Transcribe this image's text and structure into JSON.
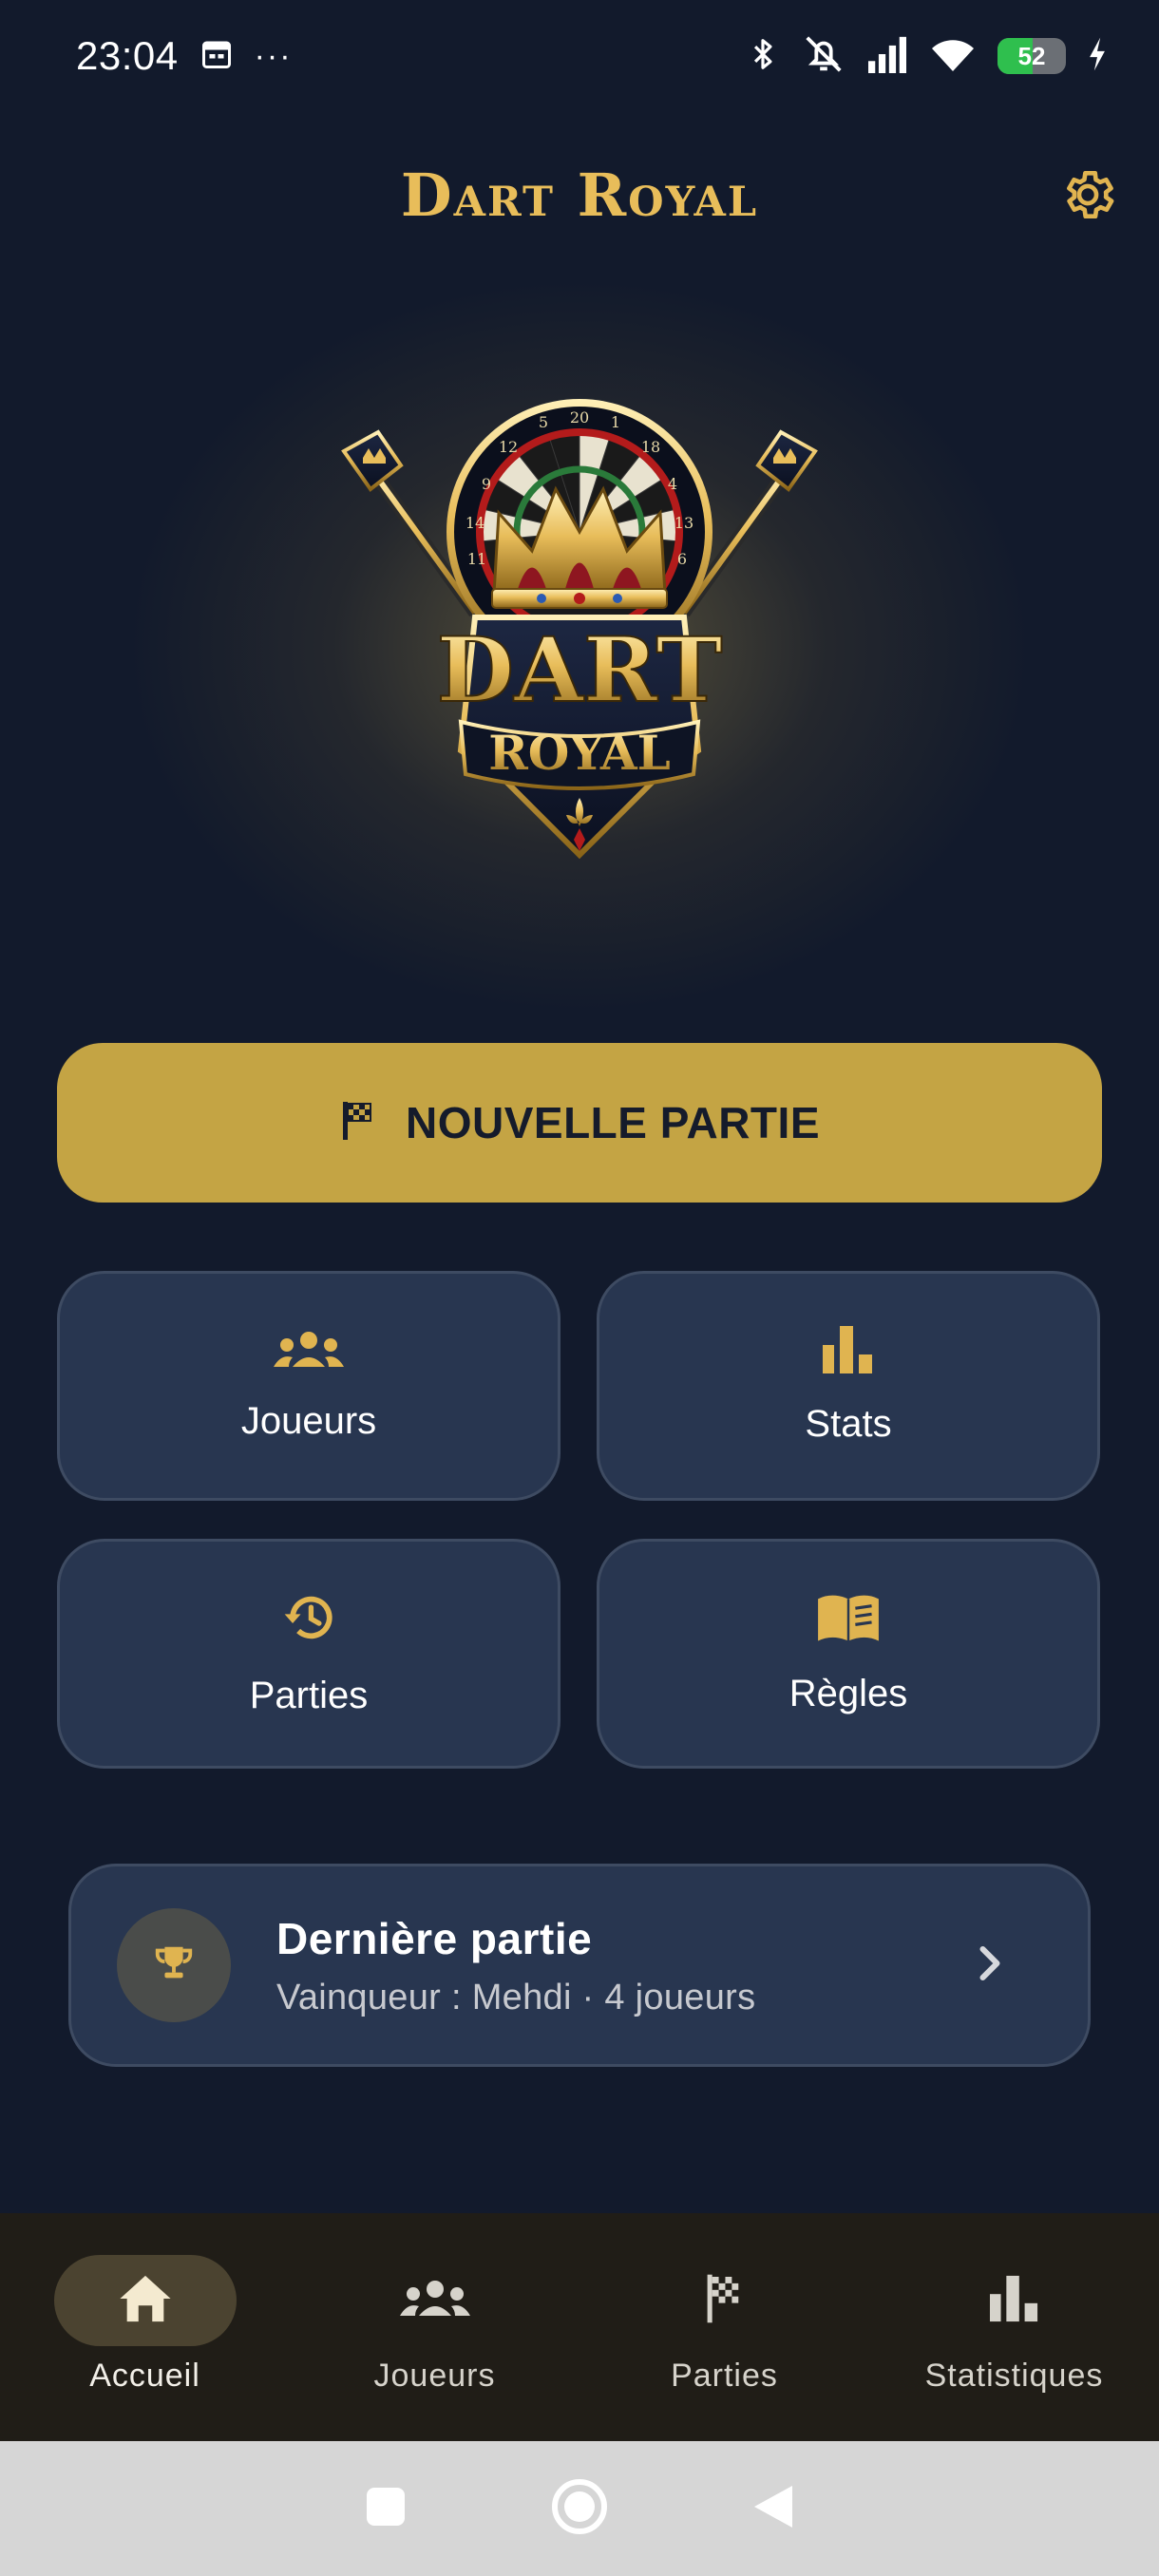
{
  "status_bar": {
    "time": "23:04",
    "overflow": "···",
    "battery": "52",
    "battery_level": 0.52,
    "icons": [
      "calendar-icon",
      "bluetooth-icon",
      "bell-off-icon",
      "signal-icon",
      "wifi-icon",
      "charging-icon"
    ]
  },
  "header": {
    "title": "Dart Royal",
    "settings_icon": "gear-icon"
  },
  "logo": {
    "word_1": "DART",
    "word_2": "ROYAL",
    "board_numbers": [
      "5",
      "20",
      "1",
      "12",
      "18",
      "9",
      "4",
      "14",
      "13",
      "11",
      "6"
    ]
  },
  "primary_action": {
    "label": "NOUVELLE PARTIE",
    "icon": "flag-icon"
  },
  "tiles": [
    {
      "label": "Joueurs",
      "icon": "group-icon"
    },
    {
      "label": "Stats",
      "icon": "bar-chart-icon"
    },
    {
      "label": "Parties",
      "icon": "history-icon"
    },
    {
      "label": "Règles",
      "icon": "book-icon"
    }
  ],
  "last_game": {
    "title": "Dernière partie",
    "subtitle": "Vainqueur : Mehdi · 4 joueurs",
    "icon": "trophy-icon"
  },
  "bottom_nav": {
    "items": [
      {
        "label": "Accueil",
        "icon": "home-icon",
        "active": true
      },
      {
        "label": "Joueurs",
        "icon": "group-icon",
        "active": false
      },
      {
        "label": "Parties",
        "icon": "checkered-flag-icon",
        "active": false
      },
      {
        "label": "Statistiques",
        "icon": "bar-chart-icon",
        "active": false
      }
    ]
  },
  "colors": {
    "background": "#121a2c",
    "accent_gold": "#c4a444",
    "title_gold": "#e8bd5a",
    "tile_bg": "#283650",
    "nav_bg": "#201d17"
  }
}
